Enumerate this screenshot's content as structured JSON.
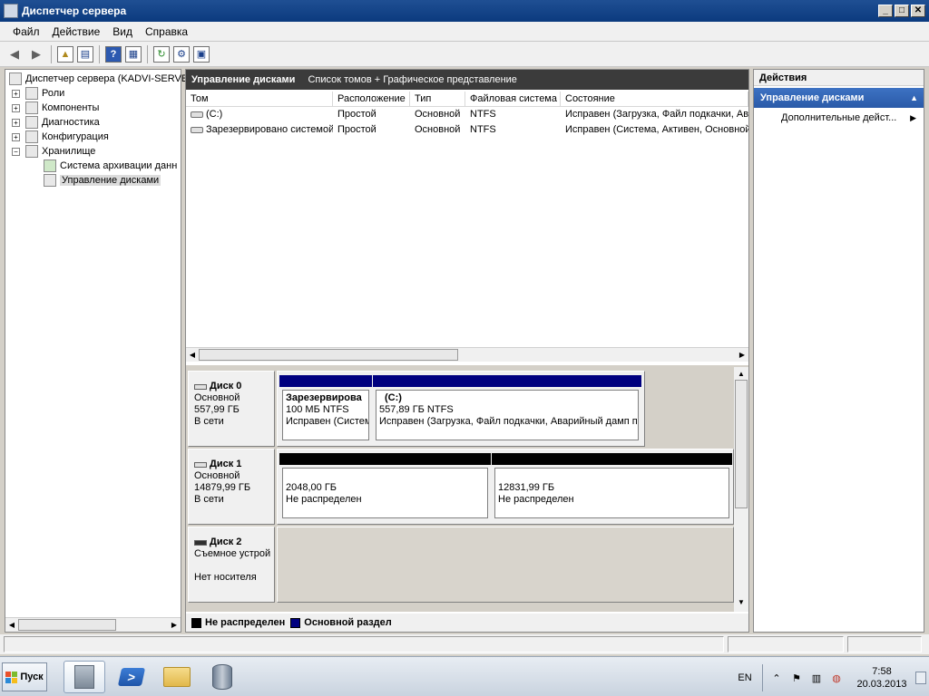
{
  "window": {
    "title": "Диспетчер сервера"
  },
  "menu": [
    "Файл",
    "Действие",
    "Вид",
    "Справка"
  ],
  "toolbar": {
    "icons": [
      "back-icon",
      "forward-icon",
      "up-folder-icon",
      "show-hide-tree-icon",
      "help-icon",
      "properties-icon",
      "refresh-icon",
      "settings-icon",
      "export-icon"
    ]
  },
  "tree": {
    "root": "Диспетчер сервера (KADVI-SERVE",
    "items": [
      {
        "label": "Роли"
      },
      {
        "label": "Компоненты"
      },
      {
        "label": "Диагностика"
      },
      {
        "label": "Конфигурация"
      },
      {
        "label": "Хранилище"
      }
    ],
    "storage_children": [
      {
        "label": "Система архивации данн"
      },
      {
        "label": "Управление дисками"
      }
    ]
  },
  "center": {
    "header_title": "Управление дисками",
    "header_sub": "Список томов + Графическое представление",
    "columns": [
      "Том",
      "Расположение",
      "Тип",
      "Файловая система",
      "Состояние"
    ],
    "rows": [
      [
        "(C:)",
        "Простой",
        "Основной",
        "NTFS",
        "Исправен (Загрузка, Файл подкачки, Ав"
      ],
      [
        "Зарезервировано системой",
        "Простой",
        "Основной",
        "NTFS",
        "Исправен (Система, Активен, Основной"
      ]
    ]
  },
  "disks": [
    {
      "name": "Диск 0",
      "type": "Основной",
      "size": "557,99 ГБ",
      "status": "В сети",
      "partitions": [
        {
          "name": "Зарезервирова",
          "size": "100 МБ NTFS",
          "status": "Исправен (Систем",
          "color": "#00007f"
        },
        {
          "name": "(C:)",
          "size": "557,89 ГБ NTFS",
          "status": "Исправен (Загрузка, Файл подкачки, Аварийный дамп п",
          "color": "#00007f"
        }
      ]
    },
    {
      "name": "Диск 1",
      "type": "Основной",
      "size": "14879,99 ГБ",
      "status": "В сети",
      "partitions": [
        {
          "size": "2048,00 ГБ",
          "status": "Не распределен",
          "color": "#000000"
        },
        {
          "size": "12831,99 ГБ",
          "status": "Не распределен",
          "color": "#000000"
        }
      ]
    },
    {
      "name": "Диск 2",
      "type": "Съемное устрой",
      "status": "Нет носителя"
    }
  ],
  "legend": [
    {
      "label": "Не распределен",
      "color": "#000000"
    },
    {
      "label": "Основной раздел",
      "color": "#00007f"
    }
  ],
  "actions": {
    "title": "Действия",
    "section": "Управление дисками",
    "items": [
      "Дополнительные дейст..."
    ]
  },
  "taskbar": {
    "start": "Пуск",
    "lang": "EN",
    "time": "7:58",
    "date": "20.03.2013"
  }
}
